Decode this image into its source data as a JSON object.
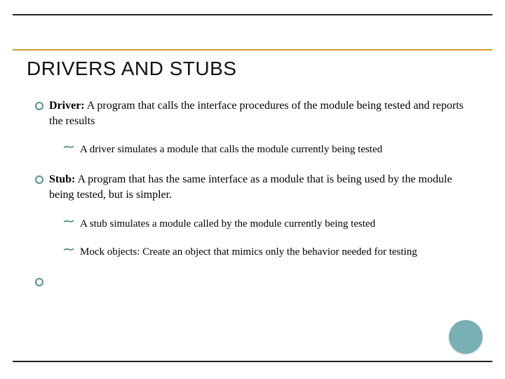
{
  "title": "DRIVERS AND STUBS",
  "items": [
    {
      "term": "Driver:",
      "body": " A program that calls the interface procedures of the module being tested and reports the results",
      "sub": [
        {
          "text": "A driver simulates a module that calls the module currently being tested"
        }
      ]
    },
    {
      "term": "Stub:",
      "body": " A program that has the same interface as a module that is being used by the module being tested,  but is simpler.",
      "sub": [
        {
          "text": "A stub simulates a module called by the module currently being tested"
        },
        {
          "text": "Mock objects: Create an object that mimics only the behavior needed for testing"
        }
      ]
    }
  ]
}
